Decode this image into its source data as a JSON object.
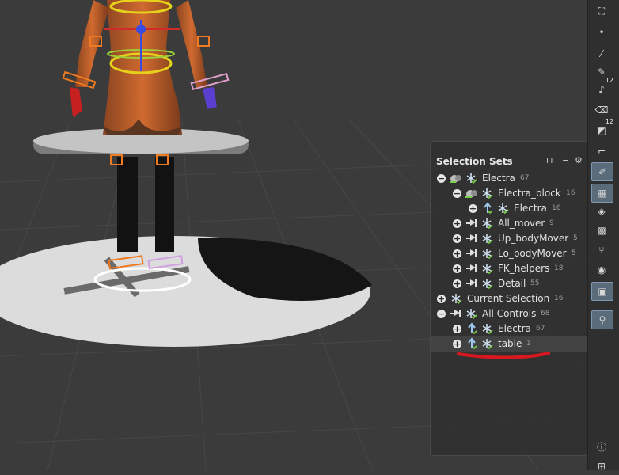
{
  "panel": {
    "title": "Selection Sets",
    "rows": [
      {
        "label": "Electra",
        "count": "67",
        "expander": "−"
      },
      {
        "label": "Electra_block",
        "count": "16",
        "expander": "−"
      },
      {
        "label": "Electra",
        "count": "16",
        "expander": "+"
      },
      {
        "label": "All_mover",
        "count": "9",
        "expander": "+"
      },
      {
        "label": "Up_bodyMover",
        "count": "5",
        "expander": "+"
      },
      {
        "label": "Lo_bodyMover",
        "count": "5",
        "expander": "+"
      },
      {
        "label": "FK_helpers",
        "count": "18",
        "expander": "+"
      },
      {
        "label": "Detail",
        "count": "55",
        "expander": "+"
      },
      {
        "label": "Current Selection",
        "count": "16",
        "expander": "+"
      },
      {
        "label": "All Controls",
        "count": "68",
        "expander": "−"
      },
      {
        "label": "Electra",
        "count": "67",
        "expander": "+"
      },
      {
        "label": "table",
        "count": "1",
        "expander": "+"
      }
    ]
  },
  "shelf": {
    "tools": [
      {
        "icon": "camera-icon",
        "glyph": "⛶",
        "sub": ""
      },
      {
        "icon": "dot-icon",
        "glyph": "•",
        "sub": ""
      },
      {
        "icon": "brush-icon",
        "glyph": "⁄",
        "sub": ""
      },
      {
        "icon": "pen-icon",
        "glyph": "✎",
        "sub": ""
      },
      {
        "icon": "paint-icon",
        "glyph": "♪",
        "sub": "12"
      },
      {
        "icon": "eraser-icon",
        "glyph": "⌫",
        "sub": ""
      },
      {
        "icon": "paint-bucket-icon",
        "glyph": "◩",
        "sub": "12"
      },
      {
        "icon": "curve-icon",
        "glyph": "⌐",
        "sub": ""
      },
      {
        "icon": "edit-icon",
        "glyph": "✐",
        "sub": ""
      },
      {
        "icon": "grid-icon",
        "glyph": "▦",
        "sub": ""
      },
      {
        "icon": "layer-icon",
        "glyph": "◈",
        "sub": ""
      },
      {
        "icon": "map-icon",
        "glyph": "▩",
        "sub": ""
      },
      {
        "icon": "branch-icon",
        "glyph": "⑂",
        "sub": ""
      },
      {
        "icon": "circle-icon",
        "glyph": "◉",
        "sub": ""
      },
      {
        "icon": "image-icon",
        "glyph": "▣",
        "sub": ""
      },
      {
        "icon": "pin-icon",
        "glyph": "⚲",
        "sub": ""
      },
      {
        "icon": "info-icon",
        "glyph": "ⓘ",
        "sub": ""
      },
      {
        "icon": "apps-icon",
        "glyph": "⊞",
        "sub": ""
      }
    ]
  },
  "colors": {
    "annotation_red": "#d8181e",
    "active_tool": "#5a6b7a",
    "handle_yellow": "#e6d21a",
    "handle_orange": "#f07a20"
  }
}
